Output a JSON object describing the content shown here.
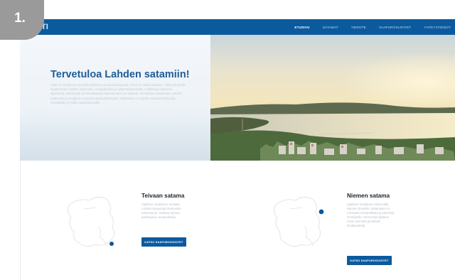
{
  "step_badge": "1.",
  "nav": {
    "logo": "TI",
    "links": [
      "ETUSIVU",
      "SATAMAT",
      "TIEDOTE",
      "VAAPUROSIJOITET",
      "YHTEYSTIEDOT"
    ]
  },
  "hero": {
    "title": "Tervetuloa Lahden satamiin!",
    "text": "Lahti on Vesijärven rannalla sijaitseva puutarhakaupunki, jossa on useita satamia. Tältä sivustolta löydät tiedot Lahden satamista, venepaikoista ja satamapalveluista. Lisätietoja satamien sijainnista, palveluista ja hinnoittelusta saat sivuston eri osioista. Tervetuloa nauttimaan Lahden satamista ja Vesijärven upeasta järvimaisemasta. Satamissa on tarjolla runsaasti palveluja veneilijöille ja muille satamavieraille."
  },
  "cards": [
    {
      "title": "Teivaan satama",
      "text": "Sijaitsee Vesijärven rannalla, Lahden kaupungin keskustan tuntumassa. Satama tarjoaa palveluja ja venepaikkoja.",
      "button": "KATSO SAAPUROSIJOITET"
    },
    {
      "title": "Niemen satama",
      "text": "Sijaitsee Vesijärven itärannalla, Niemen alueella. Satamassa on runsaasti venepaikkoja ja palveluja veneilijöille. Niemessä sijaitsee myös ravintola ja kahvila kesäkaudella.",
      "button": "KATSO SAAPUROSIJOITET"
    }
  ],
  "colors": {
    "brand": "#0c5a9e",
    "title": "#1f5d99",
    "badge": "#9a9a9a"
  }
}
